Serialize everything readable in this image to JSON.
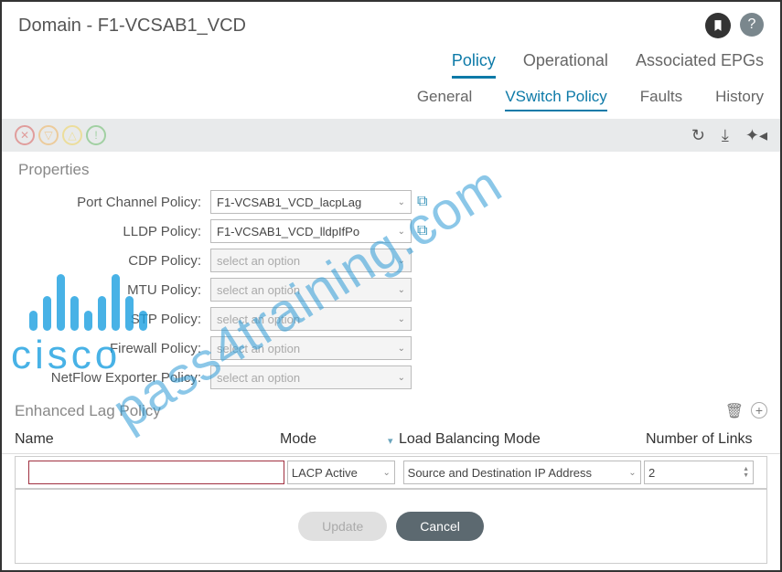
{
  "header": {
    "title": "Domain - F1-VCSAB1_VCD"
  },
  "tabsPrimary": {
    "policy": "Policy",
    "operational": "Operational",
    "epgs": "Associated EPGs"
  },
  "tabsSecondary": {
    "general": "General",
    "vswitch": "VSwitch Policy",
    "faults": "Faults",
    "history": "History"
  },
  "section": {
    "properties": "Properties",
    "lag": "Enhanced Lag Policy"
  },
  "props": {
    "portChannel": {
      "label": "Port Channel Policy:",
      "value": "F1-VCSAB1_VCD_lacpLag"
    },
    "lldp": {
      "label": "LLDP Policy:",
      "value": "F1-VCSAB1_VCD_lldpIfPo"
    },
    "cdp": {
      "label": "CDP Policy:",
      "placeholder": "select an option"
    },
    "mtu": {
      "label": "MTU Policy:",
      "placeholder": "select an option"
    },
    "stp": {
      "label": "STP Policy:",
      "placeholder": "select an option"
    },
    "firewall": {
      "label": "Firewall Policy:",
      "placeholder": "select an option"
    },
    "netflow": {
      "label": "NetFlow Exporter Policy:",
      "placeholder": "select an option"
    }
  },
  "table": {
    "headers": {
      "name": "Name",
      "mode": "Mode",
      "lbm": "Load Balancing Mode",
      "links": "Number of Links"
    },
    "row": {
      "name": "",
      "mode": "LACP Active",
      "lbm": "Source and Destination IP Address",
      "links": "2"
    }
  },
  "buttons": {
    "update": "Update",
    "cancel": "Cancel"
  },
  "watermark": "pass4training.com",
  "logo": "cisco"
}
